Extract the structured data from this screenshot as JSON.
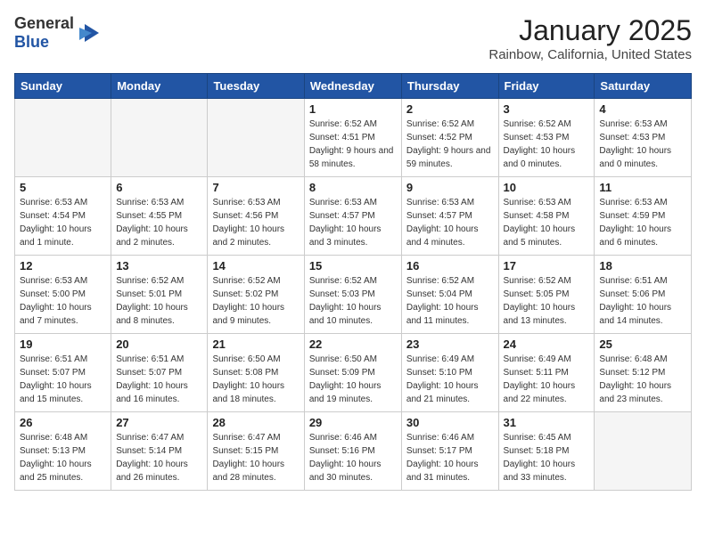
{
  "header": {
    "logo_general": "General",
    "logo_blue": "Blue",
    "title": "January 2025",
    "subtitle": "Rainbow, California, United States"
  },
  "weekdays": [
    "Sunday",
    "Monday",
    "Tuesday",
    "Wednesday",
    "Thursday",
    "Friday",
    "Saturday"
  ],
  "weeks": [
    [
      {
        "day": "",
        "info": ""
      },
      {
        "day": "",
        "info": ""
      },
      {
        "day": "",
        "info": ""
      },
      {
        "day": "1",
        "info": "Sunrise: 6:52 AM\nSunset: 4:51 PM\nDaylight: 9 hours and 58 minutes."
      },
      {
        "day": "2",
        "info": "Sunrise: 6:52 AM\nSunset: 4:52 PM\nDaylight: 9 hours and 59 minutes."
      },
      {
        "day": "3",
        "info": "Sunrise: 6:52 AM\nSunset: 4:53 PM\nDaylight: 10 hours and 0 minutes."
      },
      {
        "day": "4",
        "info": "Sunrise: 6:53 AM\nSunset: 4:53 PM\nDaylight: 10 hours and 0 minutes."
      }
    ],
    [
      {
        "day": "5",
        "info": "Sunrise: 6:53 AM\nSunset: 4:54 PM\nDaylight: 10 hours and 1 minute."
      },
      {
        "day": "6",
        "info": "Sunrise: 6:53 AM\nSunset: 4:55 PM\nDaylight: 10 hours and 2 minutes."
      },
      {
        "day": "7",
        "info": "Sunrise: 6:53 AM\nSunset: 4:56 PM\nDaylight: 10 hours and 2 minutes."
      },
      {
        "day": "8",
        "info": "Sunrise: 6:53 AM\nSunset: 4:57 PM\nDaylight: 10 hours and 3 minutes."
      },
      {
        "day": "9",
        "info": "Sunrise: 6:53 AM\nSunset: 4:57 PM\nDaylight: 10 hours and 4 minutes."
      },
      {
        "day": "10",
        "info": "Sunrise: 6:53 AM\nSunset: 4:58 PM\nDaylight: 10 hours and 5 minutes."
      },
      {
        "day": "11",
        "info": "Sunrise: 6:53 AM\nSunset: 4:59 PM\nDaylight: 10 hours and 6 minutes."
      }
    ],
    [
      {
        "day": "12",
        "info": "Sunrise: 6:53 AM\nSunset: 5:00 PM\nDaylight: 10 hours and 7 minutes."
      },
      {
        "day": "13",
        "info": "Sunrise: 6:52 AM\nSunset: 5:01 PM\nDaylight: 10 hours and 8 minutes."
      },
      {
        "day": "14",
        "info": "Sunrise: 6:52 AM\nSunset: 5:02 PM\nDaylight: 10 hours and 9 minutes."
      },
      {
        "day": "15",
        "info": "Sunrise: 6:52 AM\nSunset: 5:03 PM\nDaylight: 10 hours and 10 minutes."
      },
      {
        "day": "16",
        "info": "Sunrise: 6:52 AM\nSunset: 5:04 PM\nDaylight: 10 hours and 11 minutes."
      },
      {
        "day": "17",
        "info": "Sunrise: 6:52 AM\nSunset: 5:05 PM\nDaylight: 10 hours and 13 minutes."
      },
      {
        "day": "18",
        "info": "Sunrise: 6:51 AM\nSunset: 5:06 PM\nDaylight: 10 hours and 14 minutes."
      }
    ],
    [
      {
        "day": "19",
        "info": "Sunrise: 6:51 AM\nSunset: 5:07 PM\nDaylight: 10 hours and 15 minutes."
      },
      {
        "day": "20",
        "info": "Sunrise: 6:51 AM\nSunset: 5:07 PM\nDaylight: 10 hours and 16 minutes."
      },
      {
        "day": "21",
        "info": "Sunrise: 6:50 AM\nSunset: 5:08 PM\nDaylight: 10 hours and 18 minutes."
      },
      {
        "day": "22",
        "info": "Sunrise: 6:50 AM\nSunset: 5:09 PM\nDaylight: 10 hours and 19 minutes."
      },
      {
        "day": "23",
        "info": "Sunrise: 6:49 AM\nSunset: 5:10 PM\nDaylight: 10 hours and 21 minutes."
      },
      {
        "day": "24",
        "info": "Sunrise: 6:49 AM\nSunset: 5:11 PM\nDaylight: 10 hours and 22 minutes."
      },
      {
        "day": "25",
        "info": "Sunrise: 6:48 AM\nSunset: 5:12 PM\nDaylight: 10 hours and 23 minutes."
      }
    ],
    [
      {
        "day": "26",
        "info": "Sunrise: 6:48 AM\nSunset: 5:13 PM\nDaylight: 10 hours and 25 minutes."
      },
      {
        "day": "27",
        "info": "Sunrise: 6:47 AM\nSunset: 5:14 PM\nDaylight: 10 hours and 26 minutes."
      },
      {
        "day": "28",
        "info": "Sunrise: 6:47 AM\nSunset: 5:15 PM\nDaylight: 10 hours and 28 minutes."
      },
      {
        "day": "29",
        "info": "Sunrise: 6:46 AM\nSunset: 5:16 PM\nDaylight: 10 hours and 30 minutes."
      },
      {
        "day": "30",
        "info": "Sunrise: 6:46 AM\nSunset: 5:17 PM\nDaylight: 10 hours and 31 minutes."
      },
      {
        "day": "31",
        "info": "Sunrise: 6:45 AM\nSunset: 5:18 PM\nDaylight: 10 hours and 33 minutes."
      },
      {
        "day": "",
        "info": ""
      }
    ]
  ]
}
